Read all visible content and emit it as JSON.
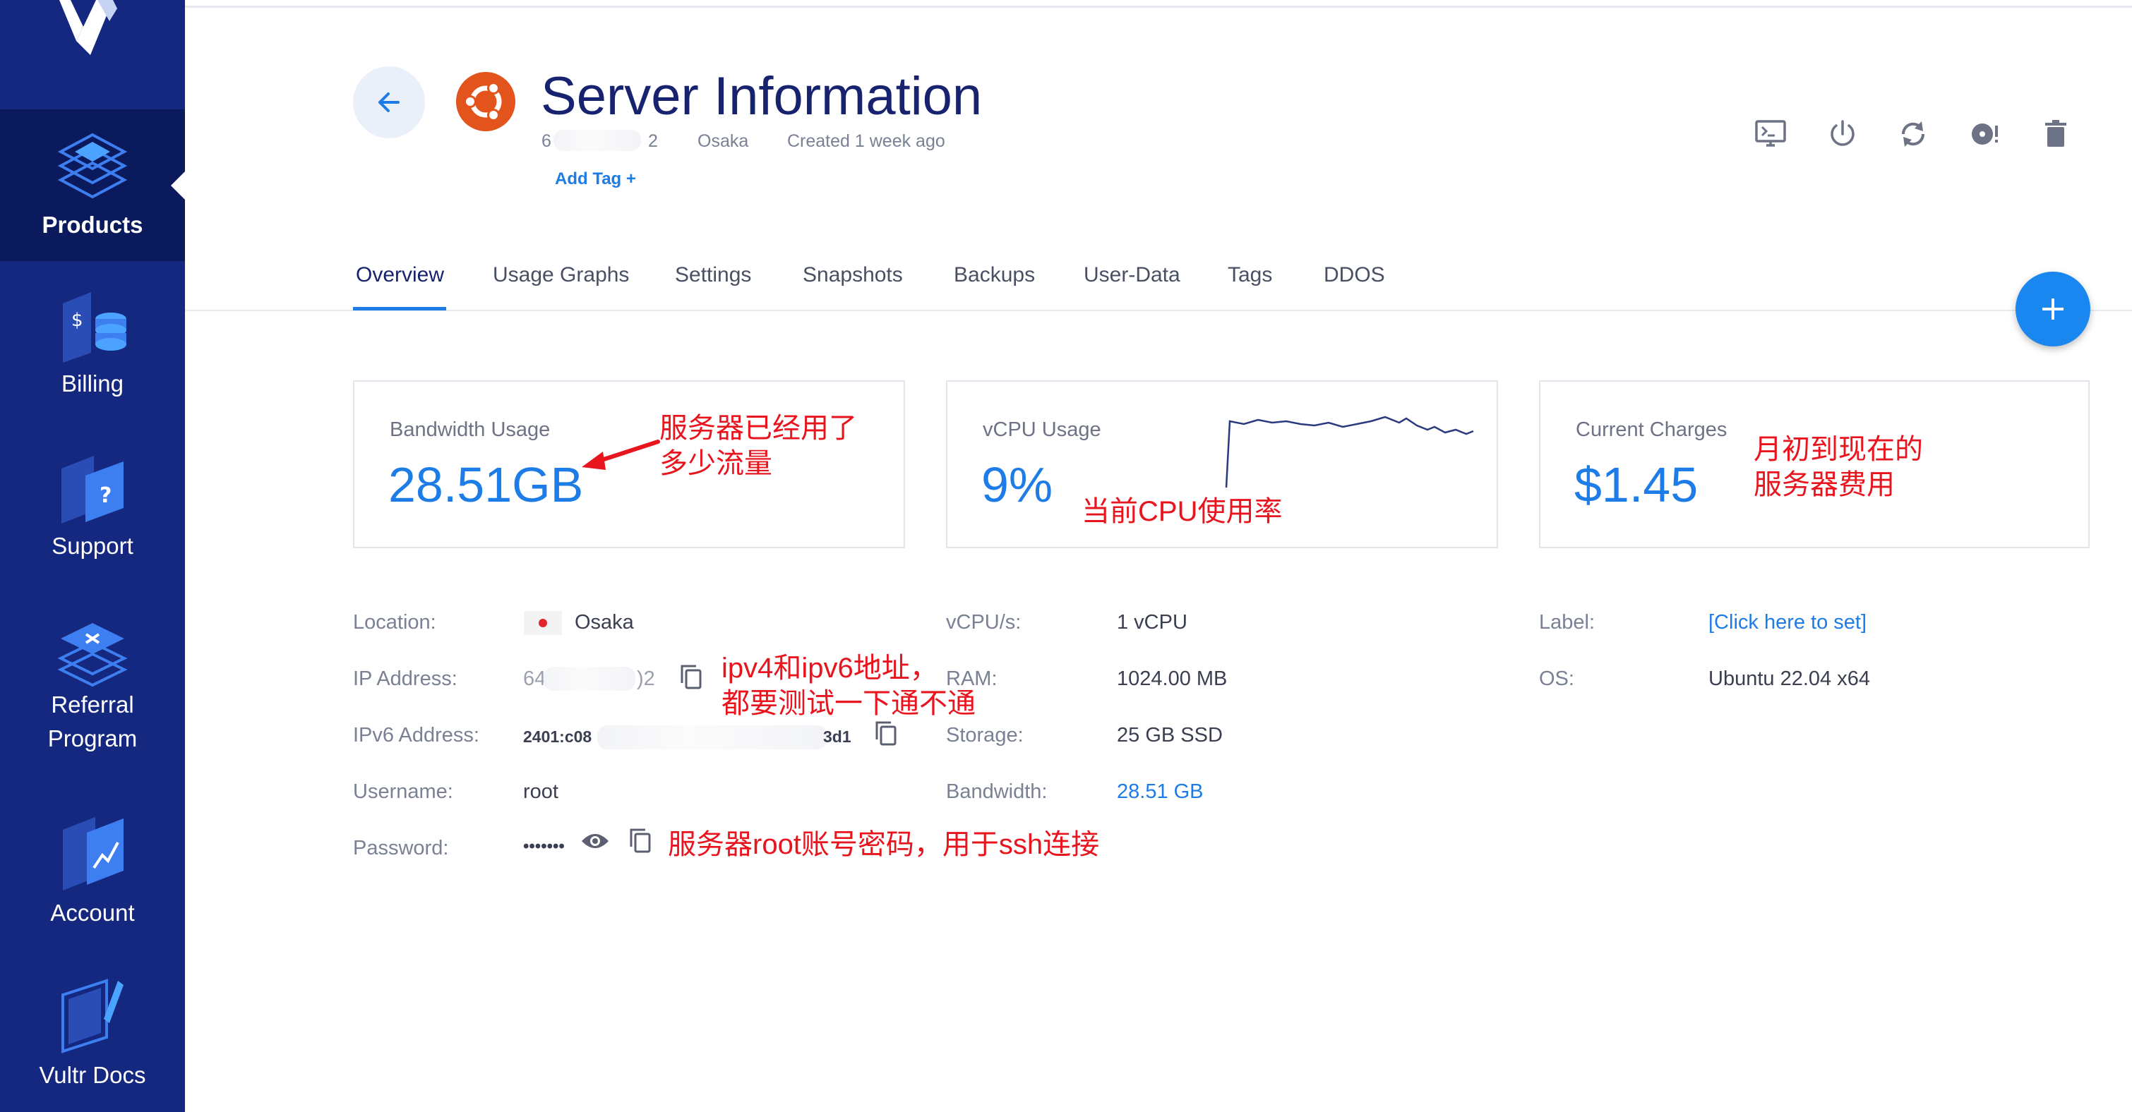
{
  "sidebar": {
    "items": [
      {
        "label": "Products",
        "icon": "products-icon",
        "active": true
      },
      {
        "label": "Billing",
        "icon": "billing-icon"
      },
      {
        "label": "Support",
        "icon": "support-icon"
      },
      {
        "label": "Referral Program",
        "icon": "referral-icon"
      },
      {
        "label": "Account",
        "icon": "account-icon"
      },
      {
        "label": "Vultr Docs",
        "icon": "docs-icon"
      }
    ]
  },
  "header": {
    "title": "Server Information",
    "os_icon": "ubuntu-icon",
    "ip_prefix": "6",
    "ip_suffix": "2",
    "location": "Osaka",
    "created": "Created 1 week ago",
    "add_tag": "Add Tag +",
    "actions": [
      "console-icon",
      "power-icon",
      "restart-icon",
      "reinstall-icon",
      "delete-icon"
    ]
  },
  "tabs": [
    "Overview",
    "Usage Graphs",
    "Settings",
    "Snapshots",
    "Backups",
    "User-Data",
    "Tags",
    "DDOS"
  ],
  "cards": {
    "bandwidth": {
      "title": "Bandwidth Usage",
      "value": "28.51GB"
    },
    "vcpu": {
      "title": "vCPU Usage",
      "value": "9%"
    },
    "charges": {
      "title": "Current Charges",
      "value": "$1.45"
    }
  },
  "details": {
    "location_label": "Location:",
    "location_value": "Osaka",
    "ip_label": "IP Address:",
    "ip_prefix": "64",
    "ip_suffix": ")2",
    "ipv6_label": "IPv6 Address:",
    "ipv6_prefix": "2401:c08",
    "ipv6_suffix": "3d1",
    "username_label": "Username:",
    "username_value": "root",
    "password_label": "Password:",
    "password_value": "•••••••",
    "vcpus_label": "vCPU/s:",
    "vcpus_value": "1 vCPU",
    "ram_label": "RAM:",
    "ram_value": "1024.00 MB",
    "storage_label": "Storage:",
    "storage_value": "25 GB SSD",
    "bandwidth_label": "Bandwidth:",
    "bandwidth_value": "28.51 GB",
    "label_label": "Label:",
    "label_value": "[Click here to set]",
    "os_label": "OS:",
    "os_value": "Ubuntu 22.04 x64"
  },
  "annotations": {
    "bandwidth": [
      "服务器已经用了",
      "多少流量"
    ],
    "cpu": "当前CPU使用率",
    "charges": [
      "月初到现在的",
      "服务器费用"
    ],
    "ip": [
      "ipv4和ipv6地址，",
      "都要测试一下通不通"
    ],
    "password": "服务器root账号密码，用于ssh连接"
  },
  "colors": {
    "sidebar": "#142880",
    "sidebar_active": "#0b1a5c",
    "accent": "#1d7ce6",
    "annotation": "#e8141e",
    "title": "#18236f"
  }
}
